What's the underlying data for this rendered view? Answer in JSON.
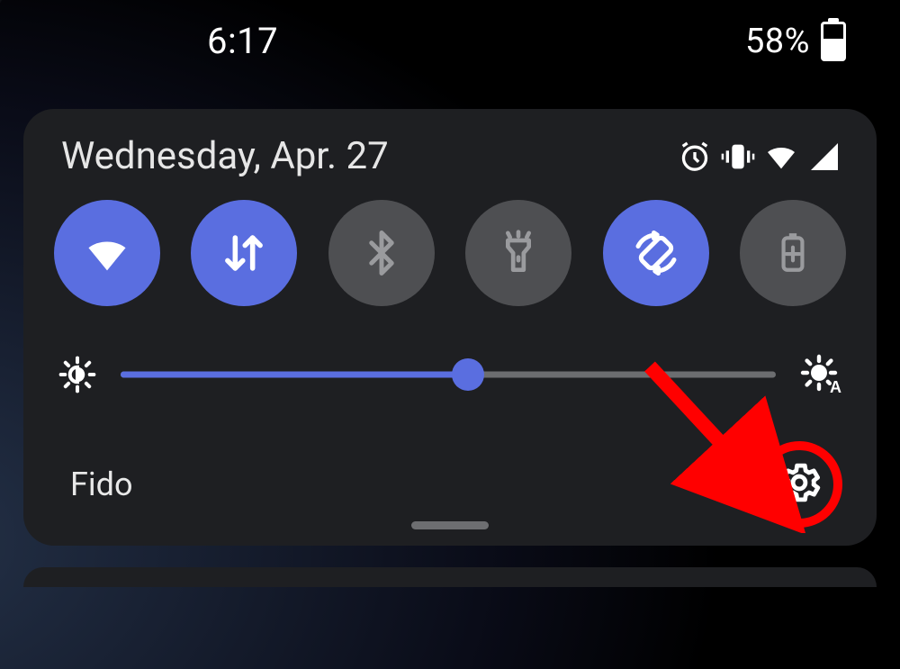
{
  "status_bar": {
    "time": "6:17",
    "battery_percent": "58%"
  },
  "panel": {
    "date": "Wednesday, Apr. 27",
    "tiles": [
      {
        "name": "wifi",
        "active": true
      },
      {
        "name": "mobile-data",
        "active": true
      },
      {
        "name": "bluetooth",
        "active": false
      },
      {
        "name": "flashlight",
        "active": false
      },
      {
        "name": "auto-rotate",
        "active": true
      },
      {
        "name": "battery-saver",
        "active": false
      }
    ],
    "brightness": {
      "value_percent": 53
    },
    "carrier": "Fido"
  },
  "colors": {
    "accent": "#5a6ee0",
    "panel_bg": "#1e1f22",
    "tile_off": "#4e4f52",
    "highlight": "#ff0000"
  }
}
